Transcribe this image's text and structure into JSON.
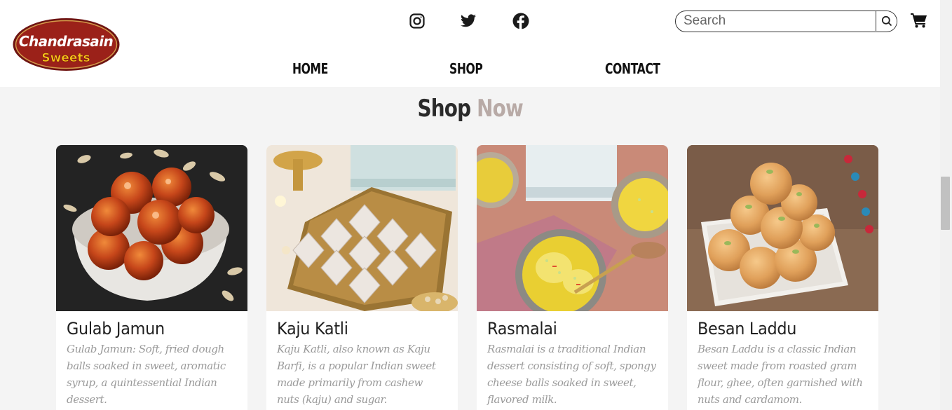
{
  "brand": {
    "logo_line1": "Chandrasain",
    "logo_line2": "Sweets"
  },
  "header": {
    "social": [
      "instagram-icon",
      "twitter-icon",
      "facebook-icon"
    ],
    "search_placeholder": "Search",
    "nav": [
      "HOME",
      "SHOP",
      "CONTACT"
    ]
  },
  "section": {
    "title_part1": "Shop",
    "title_part2": "Now"
  },
  "products": [
    {
      "name": "Gulab Jamun",
      "description": [
        "Gulab Jamun: Soft, fried dough",
        "balls soaked in sweet, aromatic",
        "syrup, a quintessential Indian",
        "dessert."
      ]
    },
    {
      "name": "Kaju Katli",
      "description": [
        "Kaju Katli, also known as Kaju",
        "Barfi, is a popular Indian sweet",
        "made primarily from cashew",
        "nuts (kaju) and sugar."
      ]
    },
    {
      "name": "Rasmalai",
      "description": [
        "Rasmalai is a traditional Indian",
        "dessert consisting of soft, spongy",
        "cheese balls soaked in sweet,",
        "flavored milk."
      ]
    },
    {
      "name": "Besan Laddu",
      "description": [
        "Besan Laddu is a classic Indian",
        "sweet made from roasted gram",
        "flour, ghee, often garnished with",
        "nuts and cardamom."
      ]
    }
  ],
  "colors": {
    "header_bg": "#ffffff",
    "page_bg": "#f4f4f4",
    "title_dark": "#2a2a2a",
    "title_light": "#b8aaa6",
    "logo_red": "#8c1d18",
    "logo_yellow": "#f5c518",
    "desc_text": "#9a9a9a"
  }
}
